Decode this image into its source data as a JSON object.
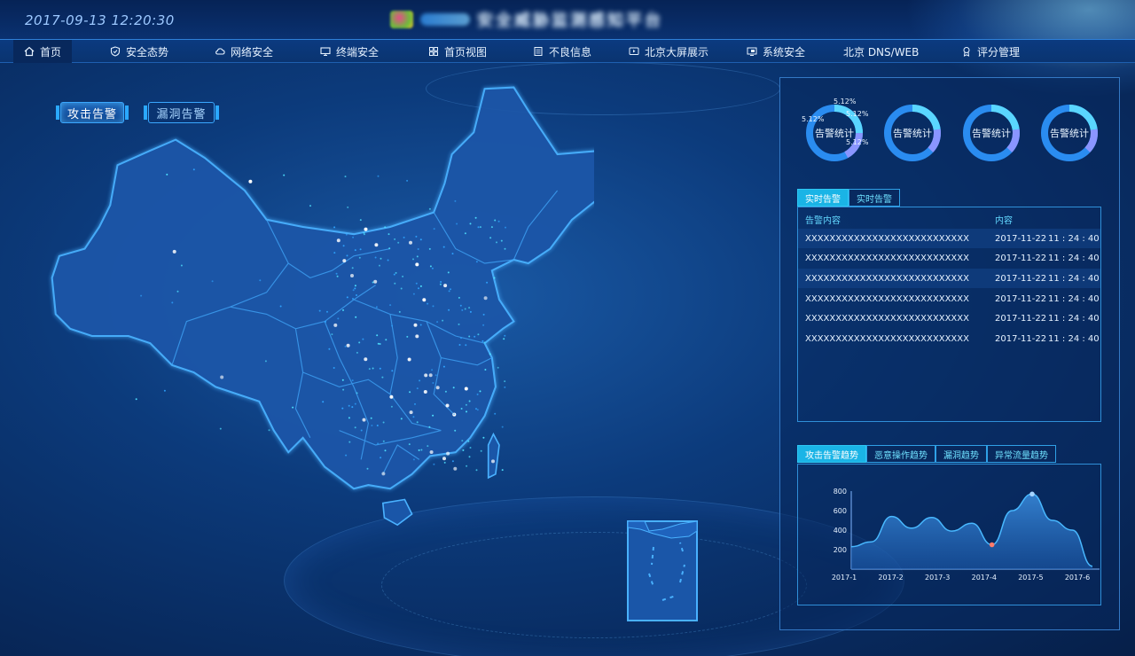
{
  "header": {
    "datetime": "2017-09-13 12:20:30",
    "brand_title": "安全威胁监测感知平台",
    "colors": {
      "bg": "#062356",
      "accent": "#2aa8ff"
    }
  },
  "nav": {
    "items": [
      {
        "label": "首页",
        "icon": "home-icon",
        "active": true
      },
      {
        "label": "安全态势",
        "icon": "shield-icon"
      },
      {
        "label": "网络安全",
        "icon": "cloud-icon"
      },
      {
        "label": "终端安全",
        "icon": "monitor-icon"
      },
      {
        "label": "首页视图",
        "icon": "grid-icon"
      },
      {
        "label": "不良信息",
        "icon": "document-icon"
      },
      {
        "label": "北京大屏展示",
        "icon": "screen-icon"
      },
      {
        "label": "系统安全",
        "icon": "system-icon"
      },
      {
        "label": "北京 DNS/WEB",
        "icon": ""
      },
      {
        "label": "评分管理",
        "icon": "badge-icon"
      }
    ]
  },
  "alarm_buttons": {
    "attack": "攻击告警",
    "vuln": "漏洞告警"
  },
  "donuts": [
    {
      "label": "告警统计",
      "pcts": [
        "5.12%",
        "5.12%",
        "5.12%",
        "5.12%"
      ]
    },
    {
      "label": "告警统计"
    },
    {
      "label": "告警统计"
    },
    {
      "label": "告警统计"
    }
  ],
  "alert_tabs": [
    "实时告警",
    "实时告警"
  ],
  "alert_table": {
    "headers": {
      "content": "告警内容",
      "time": "内容"
    },
    "rows": [
      {
        "content": "XXXXXXXXXXXXXXXXXXXXXXXXXXX",
        "date": "2017-11-22",
        "time": "11 : 24 : 40"
      },
      {
        "content": "XXXXXXXXXXXXXXXXXXXXXXXXXXX",
        "date": "2017-11-22",
        "time": "11 : 24 : 40"
      },
      {
        "content": "XXXXXXXXXXXXXXXXXXXXXXXXXXX",
        "date": "2017-11-22",
        "time": "11 : 24 : 40"
      },
      {
        "content": "XXXXXXXXXXXXXXXXXXXXXXXXXXX",
        "date": "2017-11-22",
        "time": "11 : 24 : 40"
      },
      {
        "content": "XXXXXXXXXXXXXXXXXXXXXXXXXXX",
        "date": "2017-11-22",
        "time": "11 : 24 : 40"
      },
      {
        "content": "XXXXXXXXXXXXXXXXXXXXXXXXXXX",
        "date": "2017-11-22",
        "time": "11 : 24 : 40"
      }
    ]
  },
  "trend_tabs": [
    "攻击告警趋势",
    "恶意操作趋势",
    "漏洞趋势",
    "异常流量趋势"
  ],
  "chart_data": {
    "type": "area",
    "x": [
      "2017-1",
      "2017-1.5",
      "2017-2",
      "2017-2.3",
      "2017-2.5",
      "2017-2.8",
      "2017-3",
      "2017-3.5",
      "2017-4",
      "2017-4.4",
      "2017-5",
      "2017-5.5",
      "2017-6"
    ],
    "x_ticks": [
      "2017-1",
      "2017-2",
      "2017-3",
      "2017-4",
      "2017-5",
      "2017-6"
    ],
    "values": [
      230,
      280,
      540,
      420,
      530,
      390,
      470,
      250,
      600,
      770,
      500,
      400,
      30
    ],
    "y_ticks": [
      "200",
      "400",
      "600",
      "800"
    ],
    "ylim": [
      0,
      800
    ],
    "markers": [
      {
        "index": 7,
        "color": "#ff7b6b"
      },
      {
        "index": 9,
        "color": "#a6d4ff"
      }
    ],
    "colors": {
      "line": "#48b8ff",
      "fill": "#2a73c4"
    }
  }
}
